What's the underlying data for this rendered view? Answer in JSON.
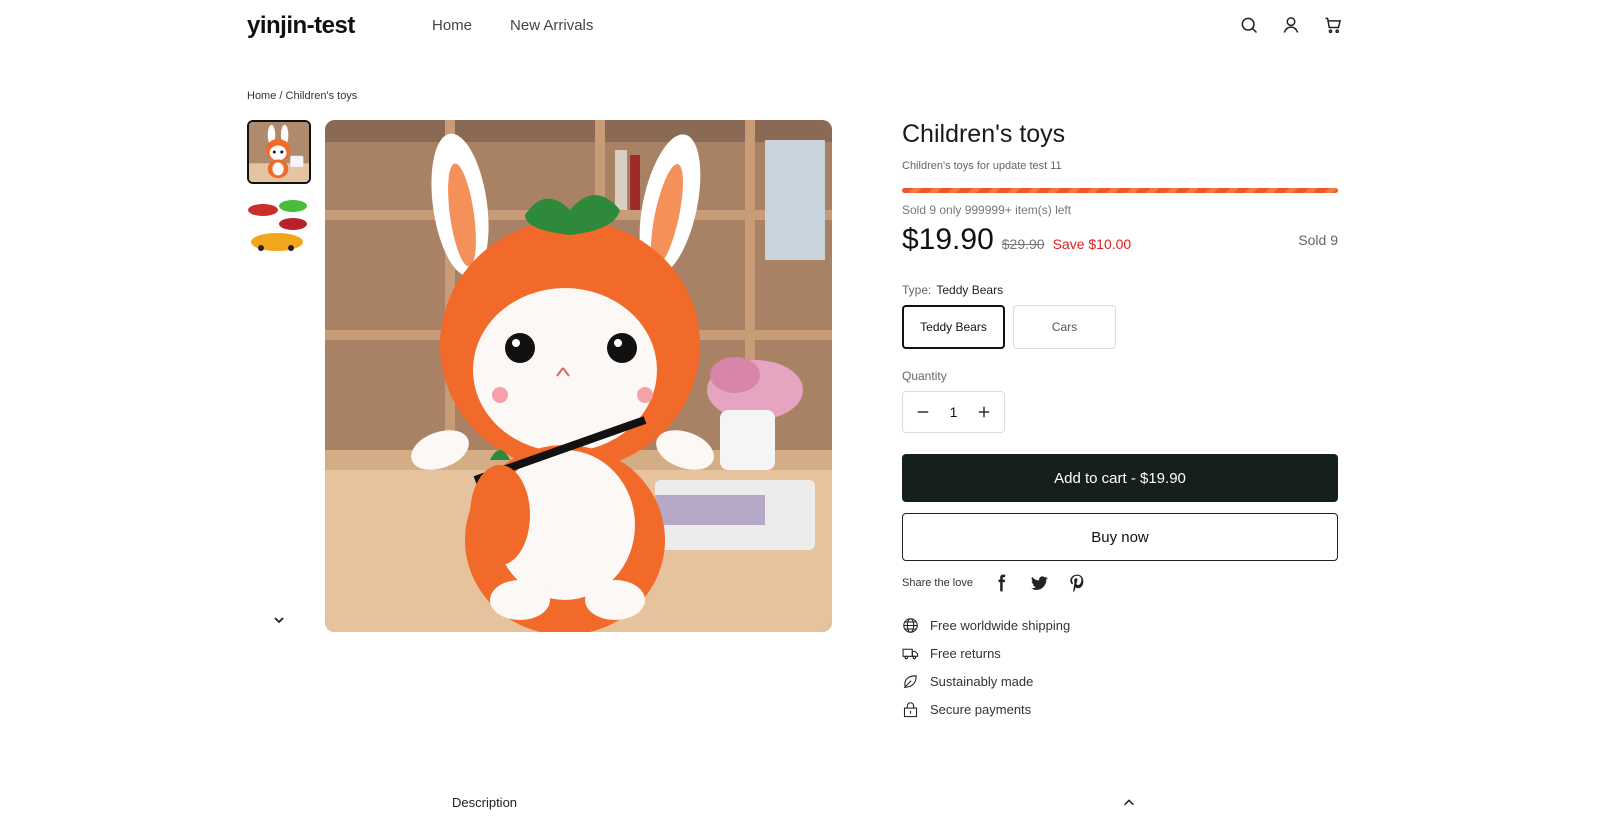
{
  "header": {
    "logo": "yinjin-test",
    "nav": [
      "Home",
      "New Arrivals"
    ],
    "icons": [
      "search-icon",
      "account-icon",
      "cart-icon"
    ]
  },
  "breadcrumb": "Home / Children's toys",
  "product": {
    "title": "Children's toys",
    "subtitle": "Children's toys for update test 11",
    "stock_text": "Sold 9 only 999999+ item(s) left",
    "price": "$19.90",
    "compare_price": "$29.90",
    "save_text": "Save $10.00",
    "sold_text": "Sold 9",
    "type_label": "Type:",
    "type_value": "Teddy Bears",
    "variants": [
      "Teddy Bears",
      "Cars"
    ],
    "quantity_label": "Quantity",
    "quantity": "1",
    "add_to_cart": "Add to cart - $19.90",
    "buy_now": "Buy now",
    "share_label": "Share the love",
    "features": [
      "Free worldwide shipping",
      "Free returns",
      "Sustainably made",
      "Secure payments"
    ]
  },
  "description": {
    "label": "Description"
  },
  "colors": {
    "accent_dark": "#15201e",
    "sale_red": "#e02020",
    "progress_orange": "#f0562d"
  }
}
